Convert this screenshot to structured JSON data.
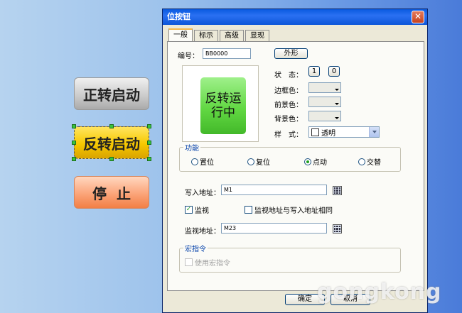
{
  "canvas": {
    "buttons": [
      {
        "label": "正转启动"
      },
      {
        "label": "反转启动"
      },
      {
        "label": "停止"
      }
    ]
  },
  "dialog": {
    "title": "位按钮",
    "close_glyph": "✕",
    "tabs": [
      "一般",
      "标示",
      "高级",
      "显现"
    ],
    "id_label": "编号：",
    "id_value": "BB0000",
    "shape_button": "外形",
    "preview_text_line1": "反转运",
    "preview_text_line2": "行中",
    "state_label": "状　态：",
    "state_options": [
      "1",
      "0"
    ],
    "border_color_label": "边框色：",
    "fore_color_label": "前景色：",
    "back_color_label": "背景色：",
    "style_label": "样　式：",
    "style_value": "透明",
    "function_group": {
      "title": "功能",
      "options": [
        "置位",
        "复位",
        "点动",
        "交替"
      ],
      "selected": "点动"
    },
    "write_address_label": "写入地址：",
    "write_address_value": "M1",
    "monitor_label": "监视",
    "monitor_checked": true,
    "same_address_label": "监视地址与写入地址相同",
    "same_address_checked": false,
    "monitor_address_label": "监视地址：",
    "monitor_address_value": "M23",
    "macro_group": {
      "title": "宏指令",
      "use_macro_label": "使用宏指令"
    },
    "ok_button": "确定",
    "cancel_button": "取消"
  },
  "watermark": "gongkong",
  "colors": {
    "title_bar": "#0a5be0",
    "dialog_bg": "#ece9d8",
    "preview_button": "#62d843",
    "forward_button": "#c9c9c9",
    "reverse_button": "#f7c800",
    "stop_button": "#fba479"
  },
  "icons": {
    "address_picker": "calculator-icon"
  }
}
